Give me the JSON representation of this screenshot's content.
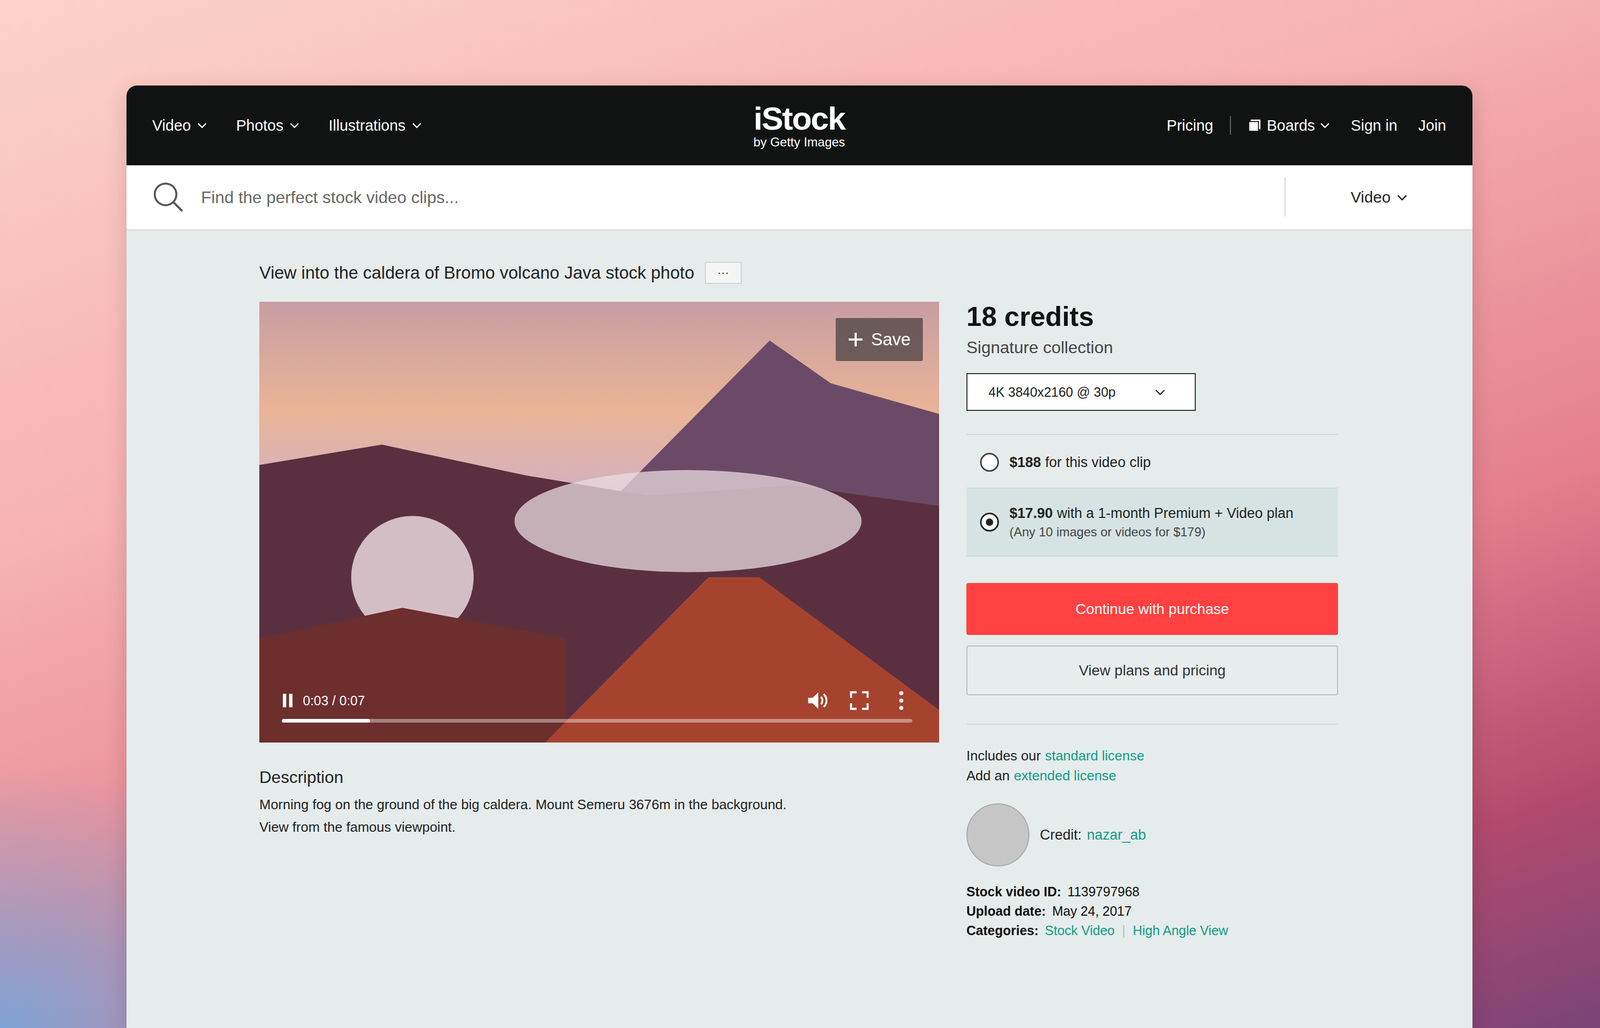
{
  "header": {
    "nav_left": [
      {
        "label": "Video"
      },
      {
        "label": "Photos"
      },
      {
        "label": "Illustrations"
      }
    ],
    "logo": {
      "brand": "iStock",
      "tagline": "by Getty Images"
    },
    "nav_right": {
      "pricing": "Pricing",
      "boards": "Boards",
      "sign_in": "Sign in",
      "join": "Join"
    }
  },
  "search": {
    "placeholder": "Find the perfect stock video clips...",
    "type": "Video"
  },
  "asset": {
    "title": "View into the caldera of Bromo volcano Java stock photo",
    "more": "···"
  },
  "player": {
    "save": "Save",
    "time": "0:03 / 0:07",
    "level": 0.14,
    "playing": true
  },
  "description": {
    "heading": "Description",
    "lines": [
      "Morning fog on the ground of the big caldera. Mount Semeru 3676m in the background.",
      "View from the famous viewpoint."
    ]
  },
  "purchase": {
    "credits": "18 credits",
    "collection": "Signature collection",
    "resolution": "4K 3840x2160 @ 30p",
    "options": [
      {
        "price": "$188",
        "text": "for this video clip",
        "note": "",
        "selected": false
      },
      {
        "price": "$17.90",
        "text": "with a 1-month Premium + Video plan",
        "note": "(Any 10 images or videos for $179)",
        "selected": true
      }
    ],
    "primary": "Continue with purchase",
    "secondary": "View plans and pricing"
  },
  "license": [
    {
      "prefix": "Includes our",
      "link": "standard license"
    },
    {
      "prefix": "Add an",
      "link": "extended license"
    }
  ],
  "credit": {
    "label": "Credit:",
    "name": "nazar_ab"
  },
  "meta": [
    {
      "label": "Stock video ID:",
      "value": "1139797968"
    },
    {
      "label": "Upload date:",
      "value": "May 24, 2017"
    }
  ],
  "categories": {
    "label": "Categories:",
    "separator": "|",
    "items": [
      "Stock Video",
      "High Angle View"
    ]
  }
}
